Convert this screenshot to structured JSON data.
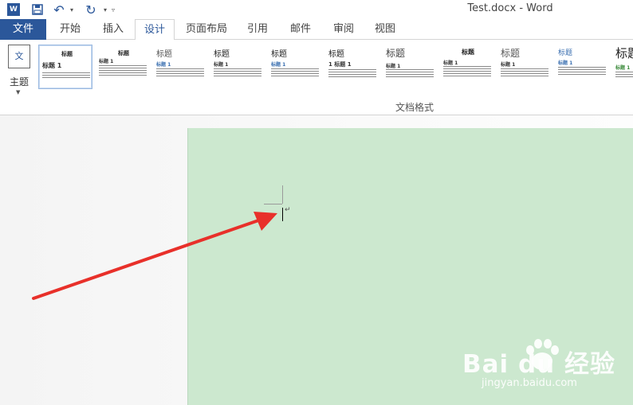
{
  "titlebar": {
    "app_badge": "W",
    "title": "Test.docx - Word",
    "save_icon": "save-icon",
    "undo_icon": "undo-icon",
    "redo_icon": "redo-icon"
  },
  "tabs": {
    "file": "文件",
    "items": [
      "开始",
      "插入",
      "设计",
      "页面布局",
      "引用",
      "邮件",
      "审阅",
      "视图"
    ],
    "active": "设计"
  },
  "ribbon": {
    "theme_icon_text": "文",
    "theme_label": "主题",
    "group_label": "文档格式",
    "styles": [
      {
        "title": "标题",
        "heading": "标题 1"
      },
      {
        "title": "标题",
        "heading": "标题 1"
      },
      {
        "title": "标题",
        "heading": "标题 1"
      },
      {
        "title": "标题",
        "heading": "标题 1"
      },
      {
        "title": "标题",
        "heading": "标题 1"
      },
      {
        "title": "标题",
        "heading": "1 标题 1"
      },
      {
        "title": "标题",
        "heading": "标题 1"
      },
      {
        "title": "标题",
        "heading": "标题 1"
      },
      {
        "title": "标题",
        "heading": "标题 1"
      },
      {
        "title": "标题",
        "heading": "标题 1"
      },
      {
        "title": "标题",
        "heading": "标题 1"
      }
    ]
  },
  "document": {
    "page_color": "#cce8cf",
    "paragraph_mark": "↵"
  },
  "watermark": {
    "logo": "Bai du 经验",
    "url": "jingyan.baidu.com"
  },
  "colors": {
    "accent": "#2b579a",
    "arrow": "#e8302a"
  }
}
